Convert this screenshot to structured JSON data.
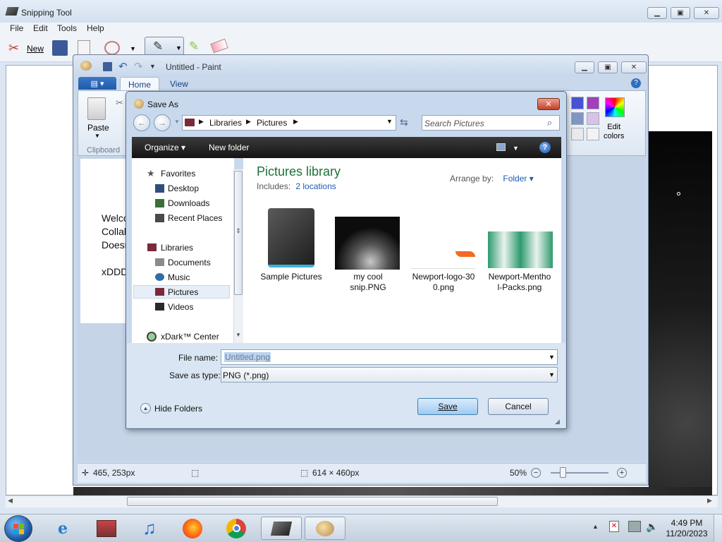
{
  "snipping_tool": {
    "title": "Snipping Tool",
    "menu": [
      "File",
      "Edit",
      "Tools",
      "Help"
    ],
    "new_label": "New"
  },
  "paint": {
    "title": "Untitled - Paint",
    "tabs": [
      "Home",
      "View"
    ],
    "paste_label": "Paste",
    "clipboard_label": "Clipboard",
    "edit_colors_label": "Edit\ncolors",
    "doc_text": "Welco\nCollab\nDoesn\n\nxDDD",
    "status": {
      "cursor_pos": "465, 253px",
      "image_size": "614 × 460px",
      "zoom": "50%"
    },
    "colors": [
      "#4a52d4",
      "#a33fb8",
      "#7f97c2",
      "#d9c2e6",
      "#eaeaea",
      "#f2f2f2"
    ]
  },
  "save_dialog": {
    "title": "Save As",
    "breadcrumb": [
      "Libraries",
      "Pictures"
    ],
    "search_placeholder": "Search Pictures",
    "organize_label": "Organize",
    "new_folder_label": "New folder",
    "nav": {
      "favorites_header": "Favorites",
      "favorites": [
        "Desktop",
        "Downloads",
        "Recent Places"
      ],
      "libraries_header": "Libraries",
      "libraries": [
        "Documents",
        "Music",
        "Pictures",
        "Videos"
      ],
      "other": "xDark™ Center"
    },
    "library_title": "Pictures library",
    "includes_label": "Includes:",
    "locations_link": "2 locations",
    "arrange_by_label": "Arrange by:",
    "arrange_by_value": "Folder",
    "files": [
      {
        "name": "Sample Pictures",
        "kind": "folder-icon"
      },
      {
        "name": "my cool\nsnip.PNG",
        "kind": "image-thumb"
      },
      {
        "name": "Newport-logo-30\n0.png",
        "kind": "image-thumb"
      },
      {
        "name": "Newport-Mentho\nl-Packs.png",
        "kind": "image-thumb"
      }
    ],
    "file_name_label": "File name:",
    "file_name_value": "Untitled.png",
    "save_type_label": "Save as type:",
    "save_type_value": "PNG (*.png)",
    "hide_folders_label": "Hide Folders",
    "save_label": "Save",
    "cancel_label": "Cancel"
  },
  "taskbar": {
    "time": "4:49 PM",
    "date": "11/20/2023"
  }
}
